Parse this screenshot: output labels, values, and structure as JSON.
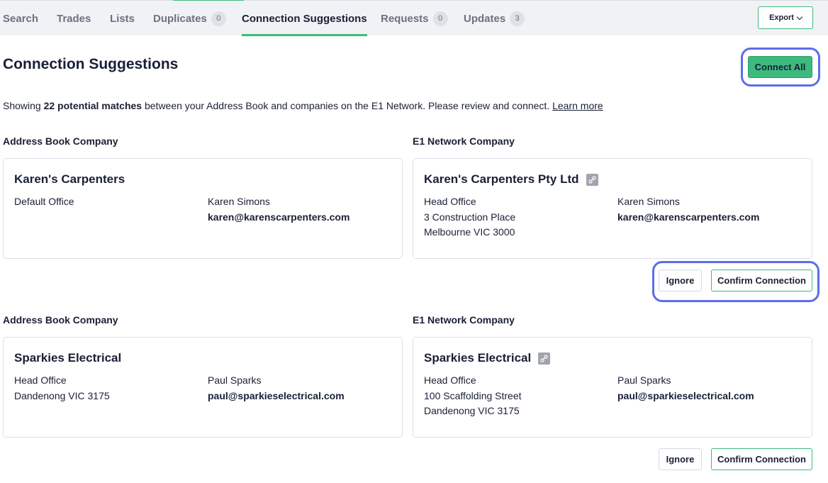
{
  "nav": {
    "tabs": [
      {
        "label": "Search"
      },
      {
        "label": "Trades"
      },
      {
        "label": "Lists"
      },
      {
        "label": "Duplicates",
        "badge": "0"
      },
      {
        "label": "Connection Suggestions",
        "active": true
      },
      {
        "label": "Requests",
        "badge": "0"
      },
      {
        "label": "Updates",
        "badge": "3"
      }
    ],
    "export_label": "Export"
  },
  "page": {
    "title": "Connection Suggestions",
    "connect_all_label": "Connect All",
    "intro_prefix": "Showing ",
    "intro_bold": "22 potential matches",
    "intro_suffix": " between your Address Book and companies on the E1 Network. Please review and connect. ",
    "learn_more": "Learn more"
  },
  "columns": {
    "left": "Address Book Company",
    "right": "E1 Network Company"
  },
  "suggestions": [
    {
      "address_book": {
        "name": "Karen's Carpenters",
        "lines": [
          "Default Office"
        ],
        "contact_name": "Karen Simons",
        "contact_email": "karen@karenscarpenters.com"
      },
      "network": {
        "name": "Karen's Carpenters Pty Ltd",
        "icon": "link-icon",
        "lines": [
          "Head Office",
          "3 Construction Place",
          "Melbourne VIC 3000"
        ],
        "contact_name": "Karen Simons",
        "contact_email": "karen@karenscarpenters.com"
      },
      "ignore_label": "Ignore",
      "confirm_label": "Confirm Connection"
    },
    {
      "address_book": {
        "name": "Sparkies Electrical",
        "lines": [
          "Head Office",
          "Dandenong VIC 3175"
        ],
        "contact_name": "Paul Sparks",
        "contact_email": "paul@sparkieselectrical.com"
      },
      "network": {
        "name": "Sparkies Electrical",
        "icon": "link-icon",
        "lines": [
          "Head Office",
          "100 Scaffolding Street",
          "Dandenong VIC 3175"
        ],
        "contact_name": "Paul Sparks",
        "contact_email": "paul@sparkieselectrical.com"
      },
      "ignore_label": "Ignore",
      "confirm_label": "Confirm Connection"
    }
  ],
  "colors": {
    "accent": "#3dba7e",
    "highlight": "#5b6ee8",
    "text": "#1a1f36"
  }
}
